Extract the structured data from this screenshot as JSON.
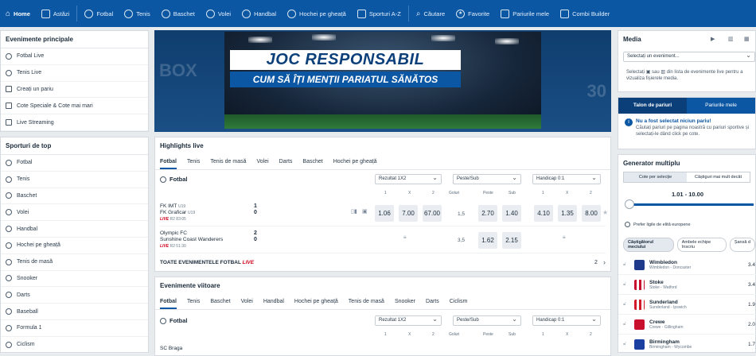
{
  "nav": {
    "items": [
      {
        "label": "Home",
        "icon": "home-icon"
      },
      {
        "label": "Astăzi",
        "icon": "calendar-icon"
      },
      {
        "label": "Fotbal",
        "icon": "football-icon"
      },
      {
        "label": "Tenis",
        "icon": "tennis-icon"
      },
      {
        "label": "Baschet",
        "icon": "basketball-icon"
      },
      {
        "label": "Volei",
        "icon": "volleyball-icon"
      },
      {
        "label": "Handbal",
        "icon": "handball-icon"
      },
      {
        "label": "Hochei pe gheață",
        "icon": "hockey-icon"
      },
      {
        "label": "Sporturi A-Z",
        "icon": "list-icon"
      },
      {
        "label": "Căutare",
        "icon": "search-icon"
      },
      {
        "label": "Favorite",
        "icon": "star-icon"
      },
      {
        "label": "Pariurile mele",
        "icon": "bets-icon"
      },
      {
        "label": "Combi Builder",
        "icon": "builder-icon"
      }
    ]
  },
  "main_events": {
    "title": "Evenimente principale",
    "items": [
      "Fotbal Live",
      "Tenis Live",
      "Creați un pariu",
      "Cote Speciale & Cote mai mari",
      "Live Streaming"
    ]
  },
  "top_sports": {
    "title": "Sporturi de top",
    "items": [
      "Fotbal",
      "Tenis",
      "Baschet",
      "Volei",
      "Handbal",
      "Hochei pe gheață",
      "Tenis de masă",
      "Snooker",
      "Darts",
      "Baseball",
      "Formula 1",
      "Ciclism"
    ]
  },
  "banner": {
    "title": "JOC RESPONSABIL",
    "subtitle": "CUM SĂ ÎȚI MENȚII PARIATUL SĂNĂTOS",
    "left_text": "BOX",
    "right_text": "30"
  },
  "highlights": {
    "title": "Highlights live",
    "tabs": [
      "Fotbal",
      "Tenis",
      "Tenis de masă",
      "Volei",
      "Darts",
      "Baschet",
      "Hochei pe gheață"
    ],
    "sport": "Fotbal",
    "market1": "Rezultat 1X2",
    "market2": "Peste/Sub",
    "market3": "Handicap 0:1",
    "h1": [
      "1",
      "X",
      "2"
    ],
    "h2": [
      "Goluri",
      "Peste",
      "Sub"
    ],
    "h3": [
      "1",
      "X",
      "2"
    ],
    "match1": {
      "team1": "FK IMT",
      "tag1": "U19",
      "team2": "FK Graficar",
      "tag2": "U19",
      "time": "R2 83:05",
      "live": "LIVE",
      "score1": "1",
      "score2": "0",
      "odds": [
        "1.06",
        "7.00",
        "67.00"
      ],
      "goals": "1,5",
      "ou": [
        "2.70",
        "1.40"
      ],
      "hc": [
        "4.10",
        "1.35",
        "8.00"
      ]
    },
    "match2": {
      "team1": "Olympic FC",
      "team2": "Sunshine Coast Wanderers",
      "time": "R2 51:30",
      "live": "LIVE",
      "score1": "2",
      "score2": "0",
      "goals": "3,5",
      "ou": [
        "1.62",
        "2.15"
      ]
    },
    "all_events": "TOATE EVENIMENTELE FOTBAL",
    "all_live": "LIVE",
    "all_count": "2"
  },
  "upcoming": {
    "title": "Evenimente viitoare",
    "tabs": [
      "Fotbal",
      "Tenis",
      "Baschet",
      "Volei",
      "Handbal",
      "Hochei pe gheață",
      "Tenis de masă",
      "Snooker",
      "Darts",
      "Ciclism"
    ],
    "sport": "Fotbal",
    "market1": "Rezultat 1X2",
    "market2": "Peste/Sub",
    "market3": "Handicap 0:1",
    "h1": [
      "1",
      "X",
      "2"
    ],
    "h2": [
      "Goluri",
      "Peste",
      "Sub"
    ],
    "h3": [
      "1",
      "X",
      "2"
    ],
    "team": "SC Braga"
  },
  "media": {
    "title": "Media",
    "select": "Selectați un eveniment...",
    "text1": "Selectați",
    "text2": "sau",
    "text3": "din lista de evenimente live pentru a vizualiza fișierele media."
  },
  "betslip": {
    "tab1": "Talon de pariuri",
    "tab2": "Pariurile mele",
    "msg_title": "Nu a fost selectat niciun pariu!",
    "msg_body": "Căutați pariuri pe pagina noastră cu pariuri sportive și selectați-le dând click pe cote."
  },
  "generator": {
    "title": "Generator multiplu",
    "tab1": "Cote per selecție",
    "tab2": "Câștiguri mai mult decât",
    "range": "1.01 - 10.00",
    "pref": "Prefer ligile de elită europene",
    "chips": [
      "Câștigătorul meciului",
      "Ambele echipe înscriu",
      "Șansă d"
    ],
    "picks": [
      {
        "team": "Wimbledon",
        "league": "Wimbledon",
        "opp": "Doncaster",
        "odd": "3.4",
        "color": "#1f3a8a"
      },
      {
        "team": "Stoke",
        "league": "Stoke",
        "opp": "Watford",
        "odd": "3.4",
        "color": "#c8102e"
      },
      {
        "team": "Sunderland",
        "league": "Sunderland",
        "opp": "Ipswich",
        "odd": "1.9",
        "color": "#d11a2a"
      },
      {
        "team": "Crewe",
        "league": "Crewe",
        "opp": "Gillingham",
        "odd": "2.0",
        "color": "#c8102e"
      },
      {
        "team": "Birmingham",
        "league": "Birmingham",
        "opp": "Wycombe",
        "odd": "1.7",
        "color": "#1a3fa0"
      }
    ]
  }
}
